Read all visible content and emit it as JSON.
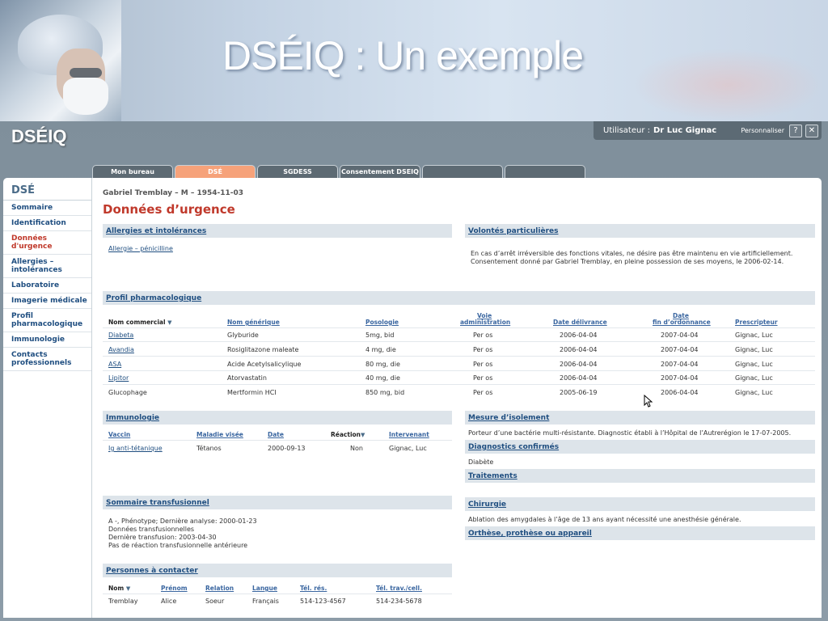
{
  "slide": {
    "title": "DSÉIQ : Un exemple"
  },
  "app": {
    "logo": "DSÉIQ",
    "user_label": "Utilisateur :",
    "user_name": "Dr Luc Gignac",
    "personalize": "Personnaliser",
    "help": "?",
    "close": "✕"
  },
  "tabs": [
    {
      "label": "Mon bureau",
      "active": false
    },
    {
      "label": "DSÉ",
      "active": true
    },
    {
      "label": "SGDESS",
      "active": false
    },
    {
      "label": "Consentement DSEIQ",
      "active": false
    },
    {
      "label": "",
      "active": false
    },
    {
      "label": "",
      "active": false
    }
  ],
  "sidebar": {
    "title": "DSÉ",
    "items": [
      {
        "label": "Sommaire"
      },
      {
        "label": "Identification"
      },
      {
        "label": "Données d'urgence",
        "active": true
      },
      {
        "label": "Allergies – intolérances"
      },
      {
        "label": "Laboratoire"
      },
      {
        "label": "Imagerie médicale"
      },
      {
        "label": "Profil pharmacologique"
      },
      {
        "label": "Immunologie"
      },
      {
        "label": "Contacts professionnels"
      }
    ]
  },
  "patient": "Gabriel Tremblay – M – 1954-11-03",
  "page_title": "Données d’urgence",
  "allergies": {
    "title": "Allergies et intolérances",
    "item": "Allergie – pénicilline"
  },
  "volontes": {
    "title": "Volontés particulières",
    "line1": "En cas d’arrêt irréversible des fonctions vitales, ne désire pas être maintenu en vie artificiellement.",
    "line2": "Consentement donné par Gabriel Tremblay, en pleine possession de ses moyens, le 2006-02-14."
  },
  "pharma": {
    "title": "Profil pharmacologique",
    "headers": {
      "nom": "Nom commercial",
      "generique": "Nom générique",
      "posologie": "Posologie",
      "voie1": "Voie",
      "voie2": "administration",
      "delivrance": "Date délivrance",
      "fin1": "Date",
      "fin2": "fin d’ordonnance",
      "prescripteur": "Prescripteur"
    },
    "rows": [
      {
        "nom": "Diabeta",
        "gen": "Glyburide",
        "pos": "5mg, bid",
        "voie": "Per os",
        "del": "2006-04-04",
        "fin": "2007-04-04",
        "presc": "Gignac, Luc"
      },
      {
        "nom": "Avandia",
        "gen": "Rosiglitazone maleate",
        "pos": "4 mg, die",
        "voie": "Per os",
        "del": "2006-04-04",
        "fin": "2007-04-04",
        "presc": "Gignac, Luc"
      },
      {
        "nom": "ASA",
        "gen": "Acide Acetylsalicylique",
        "pos": "80 mg, die",
        "voie": "Per os",
        "del": "2006-04-04",
        "fin": "2007-04-04",
        "presc": "Gignac, Luc"
      },
      {
        "nom": "Lipitor",
        "gen": "Atorvastatin",
        "pos": "40 mg, die",
        "voie": "Per os",
        "del": "2006-04-04",
        "fin": "2007-04-04",
        "presc": "Gignac, Luc"
      },
      {
        "nom": "Glucophage",
        "gen": "Mertformin HCI",
        "pos": "850 mg, bid",
        "voie": "Per os",
        "del": "2005-06-19",
        "fin": "2006-04-04",
        "presc": "Gignac, Luc"
      }
    ]
  },
  "immuno": {
    "title": "Immunologie",
    "headers": {
      "vaccin": "Vaccin",
      "maladie": "Maladie visée",
      "date": "Date",
      "reaction": "Réaction",
      "intervenant": "Intervenant"
    },
    "row": {
      "vaccin": "Ig anti-tétanique",
      "maladie": "Tétanos",
      "date": "2000-09-13",
      "reaction": "Non",
      "intervenant": "Gignac, Luc"
    }
  },
  "isolement": {
    "title": "Mesure d’isolement",
    "text": "Porteur d’une bactérie multi-résistante. Diagnostic établi à l’Hôpital de l’Autrerégion le 17-07-2005."
  },
  "diagnostics": {
    "title": "Diagnostics confirmés",
    "text": "Diabète"
  },
  "traitements": {
    "title": "Traitements"
  },
  "transfusion": {
    "title": "Sommaire transfusionnel",
    "lines": [
      "A -, Phénotype; Dernière analyse: 2000-01-23",
      "Données transfusionnelles",
      "Dernière transfusion: 2003-04-30",
      "Pas de réaction transfusionnelle antérieure"
    ]
  },
  "chirurgie": {
    "title": "Chirurgie",
    "text": "Ablation des amygdales à l’âge de 13 ans ayant nécessité une anesthésie générale."
  },
  "orthese": {
    "title": "Orthèse, prothèse ou appareil"
  },
  "contacts": {
    "title": "Personnes à contacter",
    "headers": {
      "nom": "Nom",
      "prenom": "Prénom",
      "relation": "Relation",
      "langue": "Langue",
      "tel_res": "Tél. rés.",
      "tel_trav": "Tél. trav./cell."
    },
    "row": {
      "nom": "Tremblay",
      "prenom": "Alice",
      "relation": "Soeur",
      "langue": "Français",
      "tel_res": "514-123-4567",
      "tel_trav": "514-234-5678"
    }
  }
}
